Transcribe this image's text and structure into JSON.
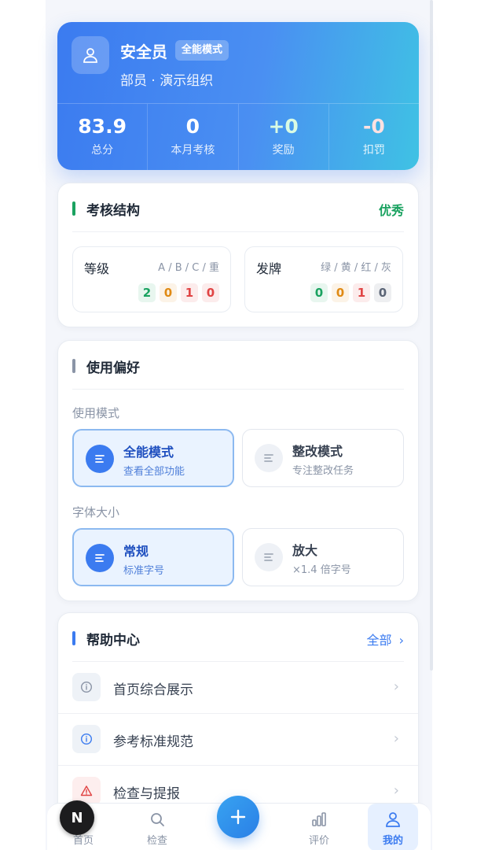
{
  "profile": {
    "name": "安全员",
    "mode_badge": "全能模式",
    "org": "部员 · 演示组织",
    "stats": [
      {
        "value": "83.9",
        "label": "总分",
        "color": "#ffffff"
      },
      {
        "value": "0",
        "label": "本月考核",
        "color": "#ffffff"
      },
      {
        "value": "+0",
        "label": "奖励",
        "color": "#d9fbe3"
      },
      {
        "value": "-0",
        "label": "扣罚",
        "color": "#ffe1e1"
      }
    ]
  },
  "structure": {
    "title": "考核结构",
    "status": "优秀",
    "grade": {
      "title": "等级",
      "legend": "A / B / C / 重",
      "values": [
        "2",
        "0",
        "1",
        "0"
      ]
    },
    "card": {
      "title": "发牌",
      "legend": "绿 / 黄 / 红 / 灰",
      "values": [
        "0",
        "0",
        "1",
        "0"
      ]
    }
  },
  "preferences": {
    "title": "使用偏好",
    "mode_label": "使用模式",
    "modes": [
      {
        "title": "全能模式",
        "sub": "查看全部功能",
        "selected": true
      },
      {
        "title": "整改模式",
        "sub": "专注整改任务",
        "selected": false
      }
    ],
    "font_label": "字体大小",
    "fonts": [
      {
        "title": "常规",
        "sub": "标准字号",
        "selected": true
      },
      {
        "title": "放大",
        "sub": "×1.4 倍字号",
        "selected": false
      }
    ]
  },
  "help": {
    "title": "帮助中心",
    "all_label": "全部",
    "items": [
      {
        "label": "首页综合展示",
        "icon": "info-icon"
      },
      {
        "label": "参考标准规范",
        "icon": "info-icon"
      },
      {
        "label": "检查与提报",
        "icon": "warning-icon"
      }
    ]
  },
  "nav": {
    "items": [
      {
        "label": "首页",
        "icon": "home-icon"
      },
      {
        "label": "检查",
        "icon": "search-icon"
      },
      {
        "label": "评价",
        "icon": "chart-icon"
      },
      {
        "label": "我的",
        "icon": "user-icon"
      }
    ],
    "fab_icon": "plus-icon",
    "badge": "N"
  },
  "colors": {
    "accent": "#3b7bf0",
    "success": "#1aa260",
    "grade_chip_colors": [
      "#1aa260",
      "#e08a14",
      "#e04444",
      "#e04444"
    ],
    "card_chip_colors": [
      "#1aa260",
      "#e08a14",
      "#e04444",
      "#5b6576"
    ]
  }
}
